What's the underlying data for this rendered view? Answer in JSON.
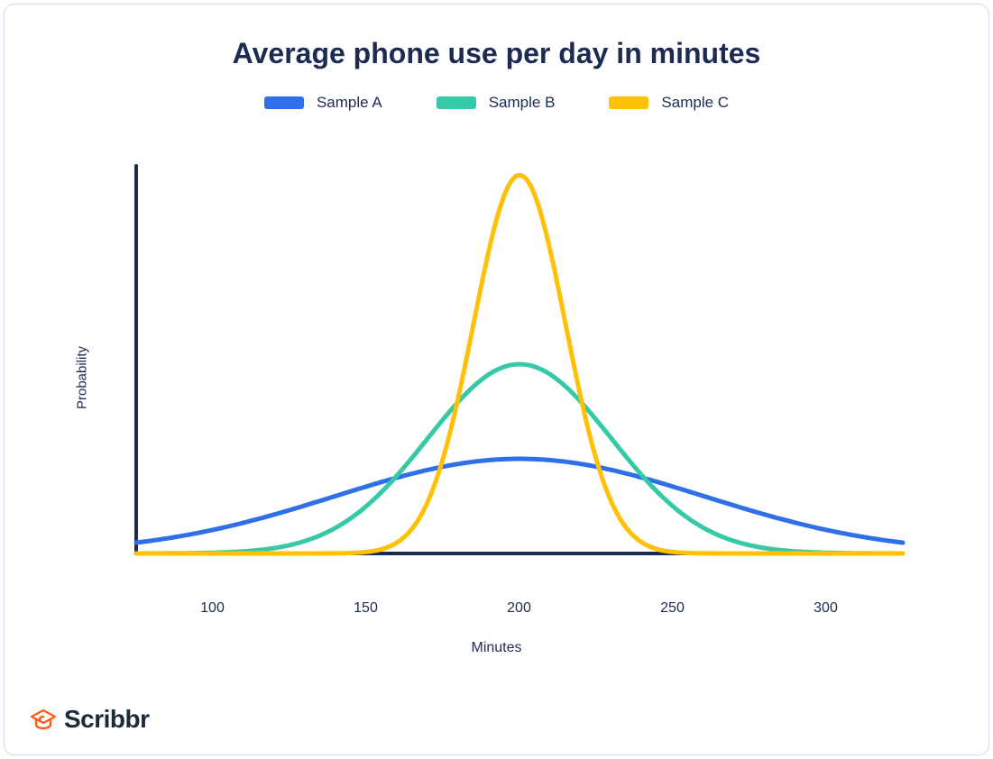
{
  "title": "Average phone use per day in minutes",
  "legend": {
    "a": "Sample A",
    "b": "Sample B",
    "c": "Sample C"
  },
  "axes": {
    "xlabel": "Minutes",
    "ylabel": "Probability",
    "ticks": {
      "t100": "100",
      "t150": "150",
      "t200": "200",
      "t250": "250",
      "t300": "300"
    }
  },
  "brand": "Scribbr",
  "colors": {
    "a": "#2f6fe7",
    "b": "#35c9a8",
    "c": "#ffc107",
    "axis": "#1d2b53"
  },
  "chart_data": {
    "type": "line",
    "title": "Average phone use per day in minutes",
    "xlabel": "Minutes",
    "ylabel": "Probability",
    "xlim": [
      75,
      325
    ],
    "note": "Three normal-distribution curves, all centered near 200 minutes, with different spreads. Sample C is tallest/narrowest, Sample B mid, Sample A widest/shortest.",
    "series": [
      {
        "name": "Sample A",
        "color": "#2f6fe7",
        "distribution": "normal",
        "mean": 200,
        "sd": 60
      },
      {
        "name": "Sample B",
        "color": "#35c9a8",
        "distribution": "normal",
        "mean": 200,
        "sd": 30
      },
      {
        "name": "Sample C",
        "color": "#ffc107",
        "distribution": "normal",
        "mean": 200,
        "sd": 15
      }
    ],
    "x_ticks": [
      100,
      150,
      200,
      250,
      300
    ]
  }
}
